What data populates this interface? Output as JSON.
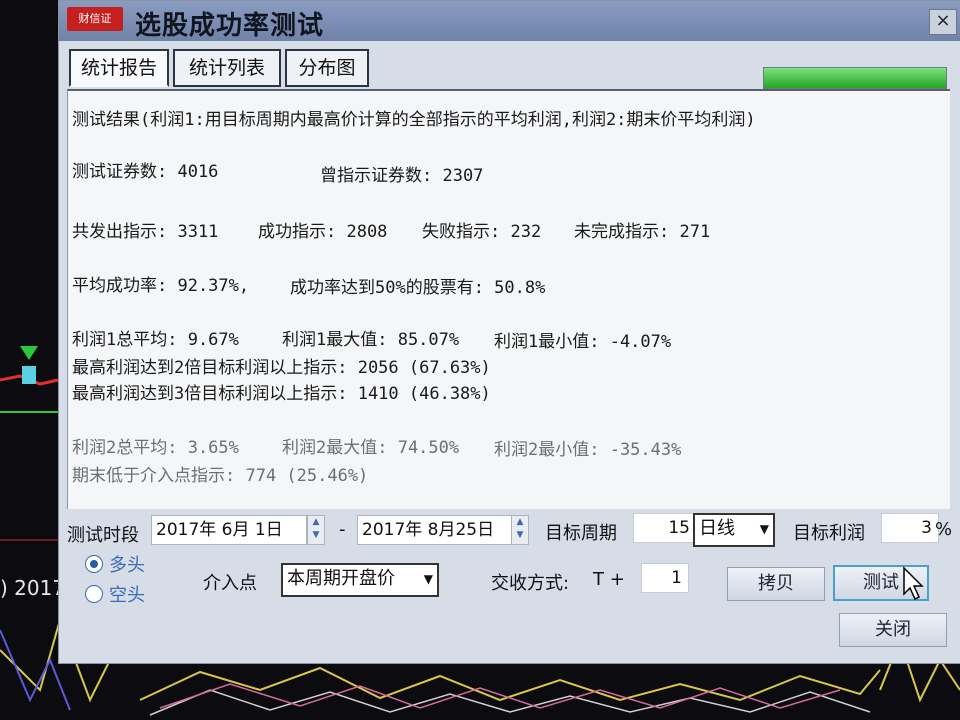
{
  "app": {
    "logo_text": "财信证",
    "window_title": "选股成功率测试",
    "close_label": "×"
  },
  "background": {
    "year_label": ") 2017"
  },
  "tabs": [
    {
      "label": "统计报告",
      "active": true
    },
    {
      "label": "统计列表",
      "active": false
    },
    {
      "label": "分布图",
      "active": false
    }
  ],
  "progress": {
    "fraction": 1.0
  },
  "report": {
    "line1": "测试结果(利润1:用目标周期内最高价计算的全部指示的平均利润,利润2:期末价平均利润)",
    "line2a": "测试证券数: 4016",
    "line2b": "曾指示证券数: 2307",
    "line3a": "共发出指示: 3311",
    "line3b": "成功指示: 2808",
    "line3c": "失败指示: 232",
    "line3d": "未完成指示: 271",
    "line4a": "平均成功率: 92.37%,",
    "line4b": "成功率达到50%的股票有: 50.8%",
    "line5a": "利润1总平均: 9.67%",
    "line5b": "利润1最大值: 85.07%",
    "line5c": "利润1最小值: -4.07%",
    "line6": "最高利润达到2倍目标利润以上指示: 2056 (67.63%)",
    "line7": "最高利润达到3倍目标利润以上指示: 1410 (46.38%)",
    "line8a": "利润2总平均: 3.65%",
    "line8b": "利润2最大值: 74.50%",
    "line8c": "利润2最小值: -35.43%",
    "line9": "期末低于介入点指示: 774 (25.46%)"
  },
  "controls": {
    "period_label": "测试时段",
    "start_date": "2017年 6月 1日",
    "dash": "-",
    "end_date": "2017年 8月25日",
    "target_period_label": "目标周期",
    "target_period_value": "15",
    "period_unit": "日线",
    "target_profit_label": "目标利润",
    "target_profit_value": "3",
    "percent": "%",
    "radio_long": "多头",
    "radio_short": "空头",
    "entry_label": "介入点",
    "entry_value": "本周期开盘价",
    "trade_label": "交收方式:",
    "trade_t": "T +",
    "trade_value": "1",
    "copy_button": "拷贝",
    "test_button": "测试",
    "close_button": "关闭"
  },
  "colors": {
    "progress_green": "#22a822",
    "radio_blue": "#2a5aa8"
  }
}
